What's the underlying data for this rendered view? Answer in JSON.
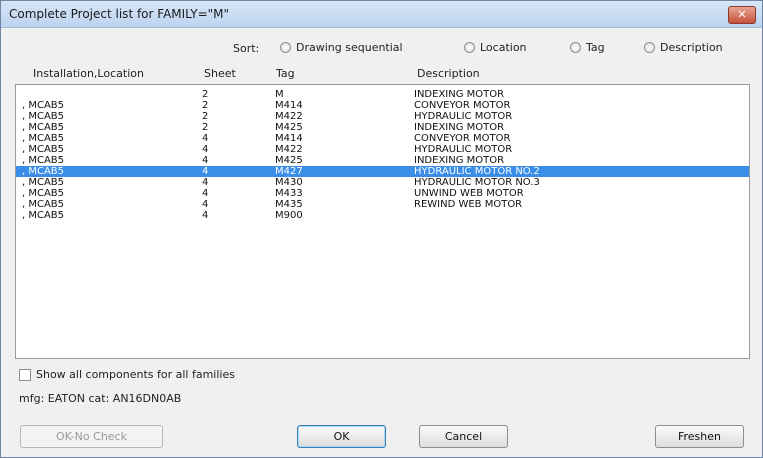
{
  "window": {
    "title": "Complete Project list for FAMILY=\"M\"",
    "close_glyph": "✕"
  },
  "sort": {
    "label": "Sort:",
    "options": [
      "Drawing sequential",
      "Location",
      "Tag",
      "Description"
    ]
  },
  "columns": [
    "Installation,Location",
    "Sheet",
    "Tag",
    "Description"
  ],
  "rows": [
    {
      "loc": "",
      "sheet": "2",
      "tag": "M",
      "desc": "INDEXING MOTOR"
    },
    {
      "loc": ", MCAB5",
      "sheet": "2",
      "tag": "M414",
      "desc": "CONVEYOR MOTOR"
    },
    {
      "loc": ", MCAB5",
      "sheet": "2",
      "tag": "M422",
      "desc": "HYDRAULIC MOTOR"
    },
    {
      "loc": ", MCAB5",
      "sheet": "2",
      "tag": "M425",
      "desc": "INDEXING MOTOR"
    },
    {
      "loc": ", MCAB5",
      "sheet": "4",
      "tag": "M414",
      "desc": "CONVEYOR MOTOR"
    },
    {
      "loc": ", MCAB5",
      "sheet": "4",
      "tag": "M422",
      "desc": "HYDRAULIC MOTOR"
    },
    {
      "loc": ", MCAB5",
      "sheet": "4",
      "tag": "M425",
      "desc": "INDEXING MOTOR"
    },
    {
      "loc": ", MCAB5",
      "sheet": "4",
      "tag": "M427",
      "desc": "HYDRAULIC MOTOR NO.2"
    },
    {
      "loc": ", MCAB5",
      "sheet": "4",
      "tag": "M430",
      "desc": "HYDRAULIC MOTOR NO.3"
    },
    {
      "loc": ", MCAB5",
      "sheet": "4",
      "tag": "M433",
      "desc": "UNWIND WEB MOTOR"
    },
    {
      "loc": ", MCAB5",
      "sheet": "4",
      "tag": "M435",
      "desc": "REWIND WEB MOTOR"
    },
    {
      "loc": ", MCAB5",
      "sheet": "4",
      "tag": "M900",
      "desc": ""
    }
  ],
  "selected_row": 7,
  "show_all_label": "Show all components for all families",
  "mfg_text": "mfg: EATON  cat: AN16DN0AB",
  "buttons": {
    "ok_no_check": "OK-No Check",
    "ok": "OK",
    "cancel": "Cancel",
    "freshen": "Freshen"
  },
  "colors": {
    "selection": "#3b8ee8",
    "title_bar": "#c8dbf2"
  }
}
